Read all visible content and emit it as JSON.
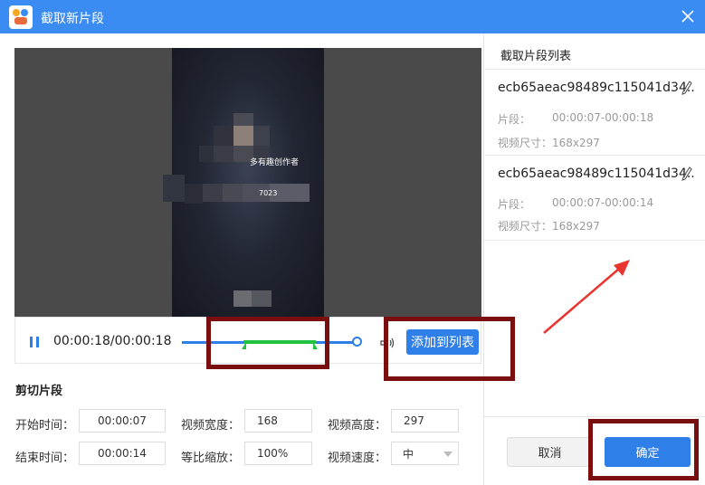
{
  "window": {
    "title": "截取新片段",
    "close_icon": "close-icon",
    "app_icon": "app-logo-icon"
  },
  "video": {
    "overlay_text_1": "多有趣创作者",
    "overlay_text_2": "7023",
    "blur_note": "mosaic-pixelated"
  },
  "player": {
    "pause_icon": "pause-icon",
    "time": "00:00:18/00:00:18",
    "volume_icon": "volume-icon",
    "add_button": "添加到列表",
    "colors": {
      "track": "#2f7fe8",
      "selection": "#22c141"
    }
  },
  "cut": {
    "section_title": "剪切片段",
    "fields": {
      "start_label": "开始时间：",
      "start_value": "00:00:07",
      "end_label": "结束时间：",
      "end_value": "00:00:14",
      "width_label": "视频宽度：",
      "width_value": "168",
      "scale_label": "等比缩放：",
      "scale_value": "100%",
      "height_label": "视频高度：",
      "height_value": "297",
      "speed_label": "视频速度：",
      "speed_value": "中"
    }
  },
  "clip_list": {
    "title": "截取片段列表",
    "items": [
      {
        "name": "ecb65aeac98489c115041d34..",
        "segment_label": "片段：",
        "segment_value": "00:00:07-00:00:18",
        "size_label": "视频尺寸：",
        "size_value": "168x297"
      },
      {
        "name": "ecb65aeac98489c115041d34..",
        "segment_label": "片段：",
        "segment_value": "00:00:07-00:00:14",
        "size_label": "视频尺寸：",
        "size_value": "168x297"
      }
    ]
  },
  "footer": {
    "cancel": "取消",
    "confirm": "确定"
  },
  "annotations": {
    "box_color": "#7a0f0f",
    "arrow_color": "#e8352f"
  }
}
